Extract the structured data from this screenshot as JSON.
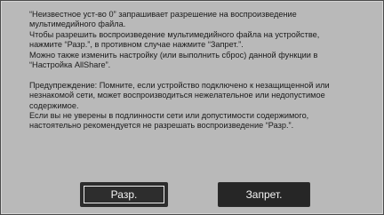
{
  "dialog": {
    "paragraphs": [
      {
        "lines": [
          "“Неизвестное уст-во 0” запрашивает разрешение на воспроизведение",
          "мультимедийного файла.",
          "Чтобы разрешить воспроизведение мультимедийного файла на устройстве,",
          "нажмите “Разр.”, в противном случае нажмите “Запрет.”.",
          "Можно также изменить настройку (или выполнить сброс) данной функции в",
          "“Настройка AllShare”."
        ]
      },
      {
        "lines": [
          "Предупреждение: Помните, если устройство подключено к незащищенной или",
          "незнакомой сети, может воспроизводиться нежелательное или недопустимое",
          "содержимое.",
          "Если вы не уверены в подлинности сети или допустимости содержимого,",
          "настоятельно рекомендуется не разрешать воспроизведение “Разр.”."
        ]
      }
    ],
    "buttons": {
      "allow_label": "Разр.",
      "deny_label": "Запрет."
    }
  }
}
